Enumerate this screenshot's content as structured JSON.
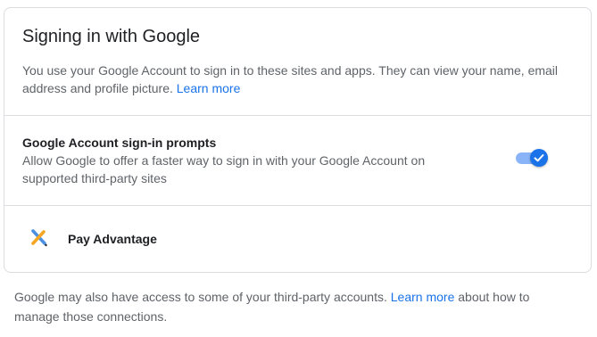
{
  "card": {
    "title": "Signing in with Google",
    "description": "You use your Google Account to sign in to these sites and apps. They can view your name, email address and profile picture.",
    "learn_more": "Learn more"
  },
  "prompts": {
    "title": "Google Account sign-in prompts",
    "description": "Allow Google to offer a faster way to sign in with your Google Account on supported third-party sites",
    "toggle_on": true,
    "accent_color": "#1a73e8"
  },
  "apps": [
    {
      "name": "Pay Advantage",
      "icon": "pay-advantage-logo-icon"
    }
  ],
  "footer": {
    "text_before": "Google may also have access to some of your third-party accounts.",
    "learn_more": "Learn more",
    "text_after": "about how to manage those connections."
  }
}
